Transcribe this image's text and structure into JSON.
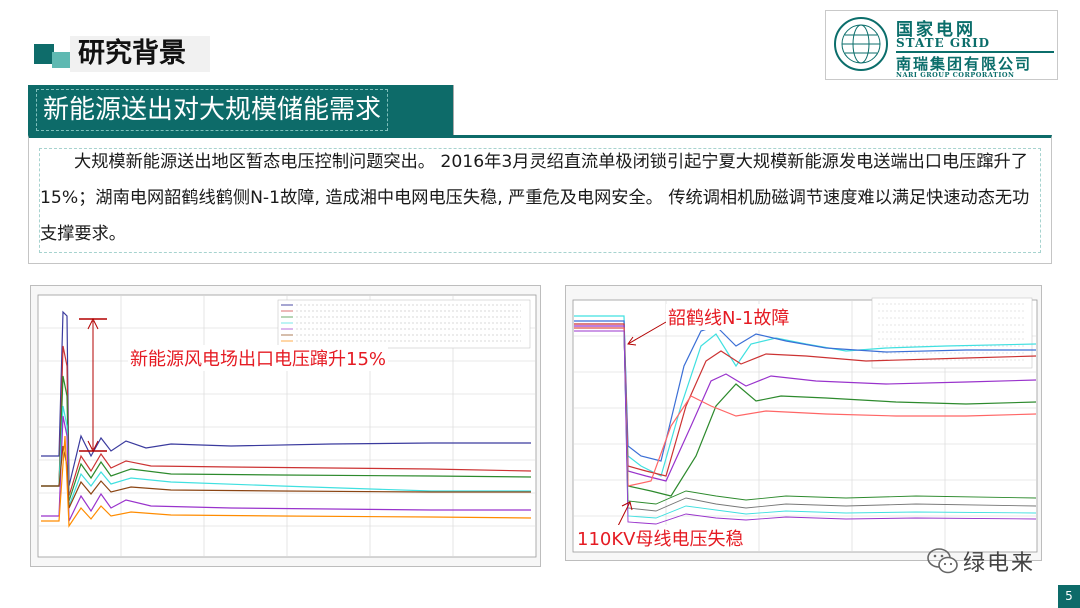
{
  "title": "研究背景",
  "logo": {
    "cn": "国家电网",
    "en": "STATE GRID",
    "cn2": "南瑞集团有限公司",
    "en2": "NARI GROUP CORPORATION"
  },
  "section_title": "新能源送出对大规模储能需求",
  "paragraph": "大规模新能源送出地区暂态电压控制问题突出。 2016年3月灵绍直流单极闭锁引起宁夏大规模新能源发电送端出口电压蹿升了15%；湖南电网韶鹤线鹤侧N-1故障, 造成湘中电网电压失稳, 严重危及电网安全。 传统调相机励磁调节速度难以满足快速动态无功支撑要求。",
  "figure_left": {
    "callout": "新能源风电场出口电压蹿升15%"
  },
  "figure_right": {
    "callout_fault": "韶鹤线N-1故障",
    "callout_collapse": "110KV母线电压失稳"
  },
  "watermark": "绿电来",
  "page_number": "5",
  "colors": {
    "brand_teal": "#0d6b69",
    "accent_red": "#e51b23"
  }
}
